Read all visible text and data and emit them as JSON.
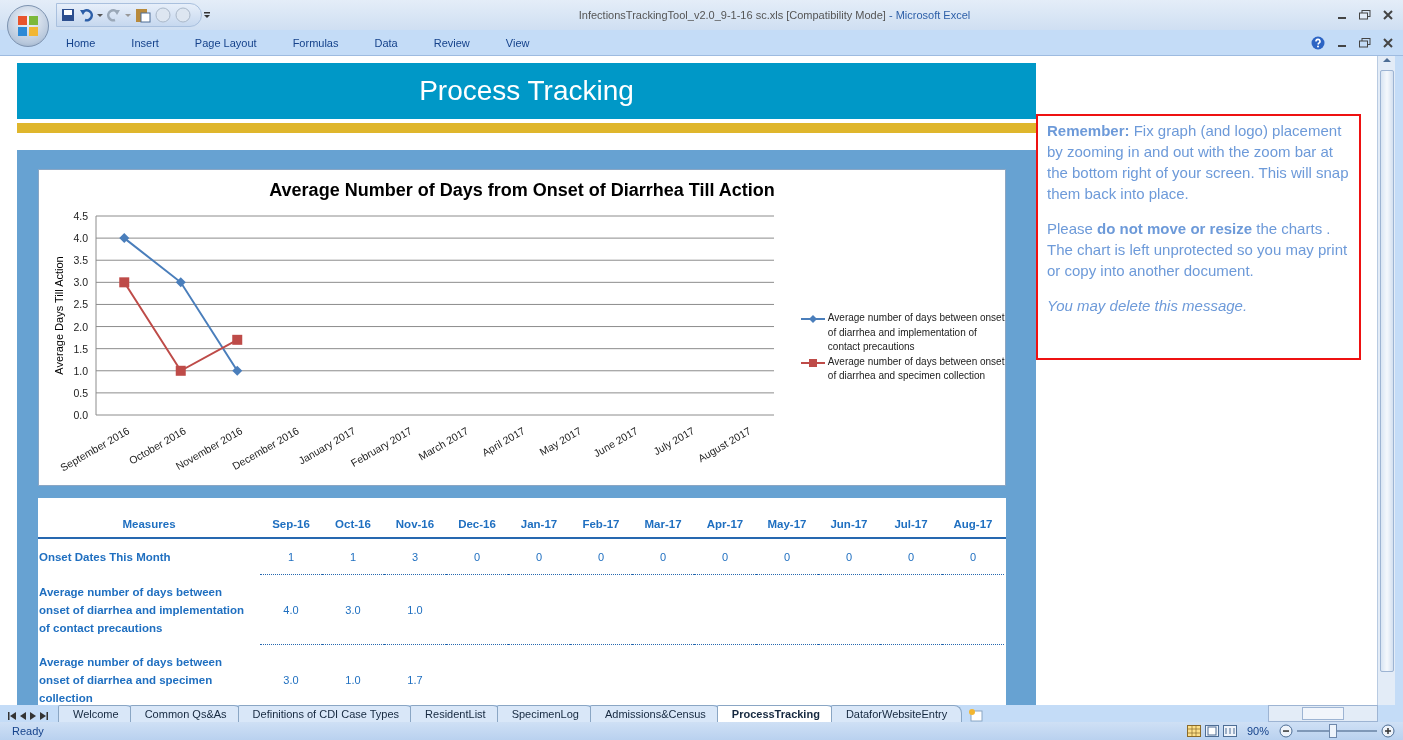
{
  "window": {
    "title": "InfectionsTrackingTool_v2.0_9-1-16 sc.xls  [Compatibility Mode]",
    "app_name": "- Microsoft Excel"
  },
  "ribbon_tabs": [
    "Home",
    "Insert",
    "Page Layout",
    "Formulas",
    "Data",
    "Review",
    "View"
  ],
  "banner": {
    "title": "Process Tracking"
  },
  "chart": {
    "chart_data": {
      "type": "line",
      "title": "Average Number of Days from Onset of Diarrhea Till Action",
      "ylabel": "Average Days Till Action",
      "categories": [
        "September 2016",
        "October 2016",
        "November 2016",
        "December 2016",
        "January 2017",
        "February 2017",
        "March 2017",
        "April 2017",
        "May 2017",
        "June 2017",
        "July 2017",
        "August 2017"
      ],
      "series": [
        {
          "name": "Average number of days between onset of diarrhea and implementation of contact precautions",
          "color": "#4a7ebb",
          "marker": "diamond",
          "values": [
            4.0,
            3.0,
            1.0,
            null,
            null,
            null,
            null,
            null,
            null,
            null,
            null,
            null
          ]
        },
        {
          "name": "Average number of days between onset of diarrhea and specimen collection",
          "color": "#be4b48",
          "marker": "square",
          "values": [
            3.0,
            1.0,
            1.7,
            null,
            null,
            null,
            null,
            null,
            null,
            null,
            null,
            null
          ]
        }
      ],
      "ylim": [
        0,
        4.5
      ],
      "grid": true,
      "yticks": [
        {
          "value": 0,
          "label": "0.0"
        },
        {
          "value": 0.5,
          "label": "0.5"
        },
        {
          "value": 1,
          "label": "1.0"
        },
        {
          "value": 1.5,
          "label": "1.5"
        },
        {
          "value": 2,
          "label": "2.0"
        },
        {
          "value": 2.5,
          "label": "2.5"
        },
        {
          "value": 3,
          "label": "3.0"
        },
        {
          "value": 3.5,
          "label": "3.5"
        },
        {
          "value": 4,
          "label": "4.0"
        },
        {
          "value": 4.5,
          "label": "4.5"
        }
      ]
    }
  },
  "table": {
    "columns": [
      "Measures",
      "Sep-16",
      "Oct-16",
      "Nov-16",
      "Dec-16",
      "Jan-17",
      "Feb-17",
      "Mar-17",
      "Apr-17",
      "May-17",
      "Jun-17",
      "Jul-17",
      "Aug-17"
    ],
    "rows": [
      {
        "measure": "Onset Dates This Month",
        "values": [
          "1",
          "1",
          "3",
          "0",
          "0",
          "0",
          "0",
          "0",
          "0",
          "0",
          "0",
          "0"
        ]
      },
      {
        "measure": "Average number of days between onset of diarrhea and implementation of contact precautions",
        "values": [
          "4.0",
          "3.0",
          "1.0"
        ]
      },
      {
        "measure": "Average number of days between onset of diarrhea and specimen collection",
        "values": [
          "3.0",
          "1.0",
          "1.7"
        ]
      }
    ]
  },
  "note": {
    "paragraphs": [
      {
        "kind": "plain",
        "text": "**Remember:** Fix graph (and logo) placement by zooming in and out with the zoom bar at the bottom right of your screen. This will snap them back into place."
      },
      {
        "kind": "plain",
        "text": "Please **do not move or resize** the charts . The chart is left unprotected so you may print or copy into another document."
      },
      {
        "kind": "aside",
        "text": "You may delete this message."
      }
    ]
  },
  "sheet_tabs": [
    {
      "label": "Welcome",
      "selected": false
    },
    {
      "label": "Common Qs&As",
      "selected": false
    },
    {
      "label": "Definitions of CDI Case Types",
      "selected": false
    },
    {
      "label": "ResidentList",
      "selected": false
    },
    {
      "label": "SpecimenLog",
      "selected": false
    },
    {
      "label": "Admissions&Census",
      "selected": false
    },
    {
      "label": "ProcessTracking",
      "selected": true
    },
    {
      "label": "DataforWebsiteEntry",
      "selected": false
    }
  ],
  "status_bar": {
    "status": "Ready",
    "zoom": "90%",
    "zoom_slider": {
      "level": 0.45
    }
  }
}
